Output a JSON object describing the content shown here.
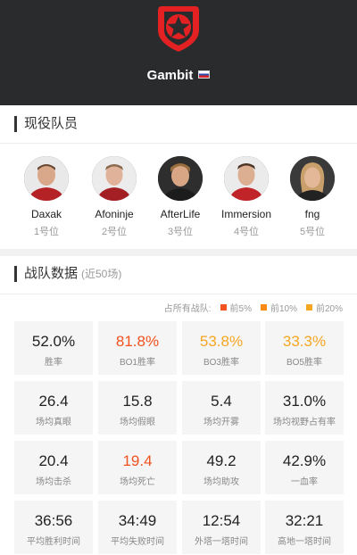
{
  "header": {
    "team_name": "Gambit"
  },
  "roster": {
    "title": "现役队员",
    "players": [
      {
        "name": "Daxak",
        "position": "1号位"
      },
      {
        "name": "Afoninje",
        "position": "2号位"
      },
      {
        "name": "AfterLife",
        "position": "3号位"
      },
      {
        "name": "Immersion",
        "position": "4号位"
      },
      {
        "name": "fng",
        "position": "5号位"
      }
    ]
  },
  "stats": {
    "title": "战队数据",
    "subtitle": "(近50场)",
    "legend": {
      "label": "占所有战队:",
      "items": [
        {
          "label": "前5%",
          "color": "#f1521f"
        },
        {
          "label": "前10%",
          "color": "#f98a12"
        },
        {
          "label": "前20%",
          "color": "#f5a623"
        }
      ]
    },
    "cells": [
      {
        "value": "52.0%",
        "label": "胜率"
      },
      {
        "value": "81.8%",
        "label": "BO1胜率"
      },
      {
        "value": "53.8%",
        "label": "BO3胜率"
      },
      {
        "value": "33.3%",
        "label": "BO5胜率"
      },
      {
        "value": "26.4",
        "label": "场均真眼"
      },
      {
        "value": "15.8",
        "label": "场均假眼"
      },
      {
        "value": "5.4",
        "label": "场均开雾"
      },
      {
        "value": "31.0%",
        "label": "场均视野占有率"
      },
      {
        "value": "20.4",
        "label": "场均击杀"
      },
      {
        "value": "19.4",
        "label": "场均死亡"
      },
      {
        "value": "49.2",
        "label": "场均助攻"
      },
      {
        "value": "42.9%",
        "label": "一血率"
      },
      {
        "value": "36:56",
        "label": "平均胜利时间"
      },
      {
        "value": "34:49",
        "label": "平均失败时间"
      },
      {
        "value": "12:54",
        "label": "外塔一塔时间"
      },
      {
        "value": "32:21",
        "label": "高地一塔时间"
      }
    ]
  }
}
